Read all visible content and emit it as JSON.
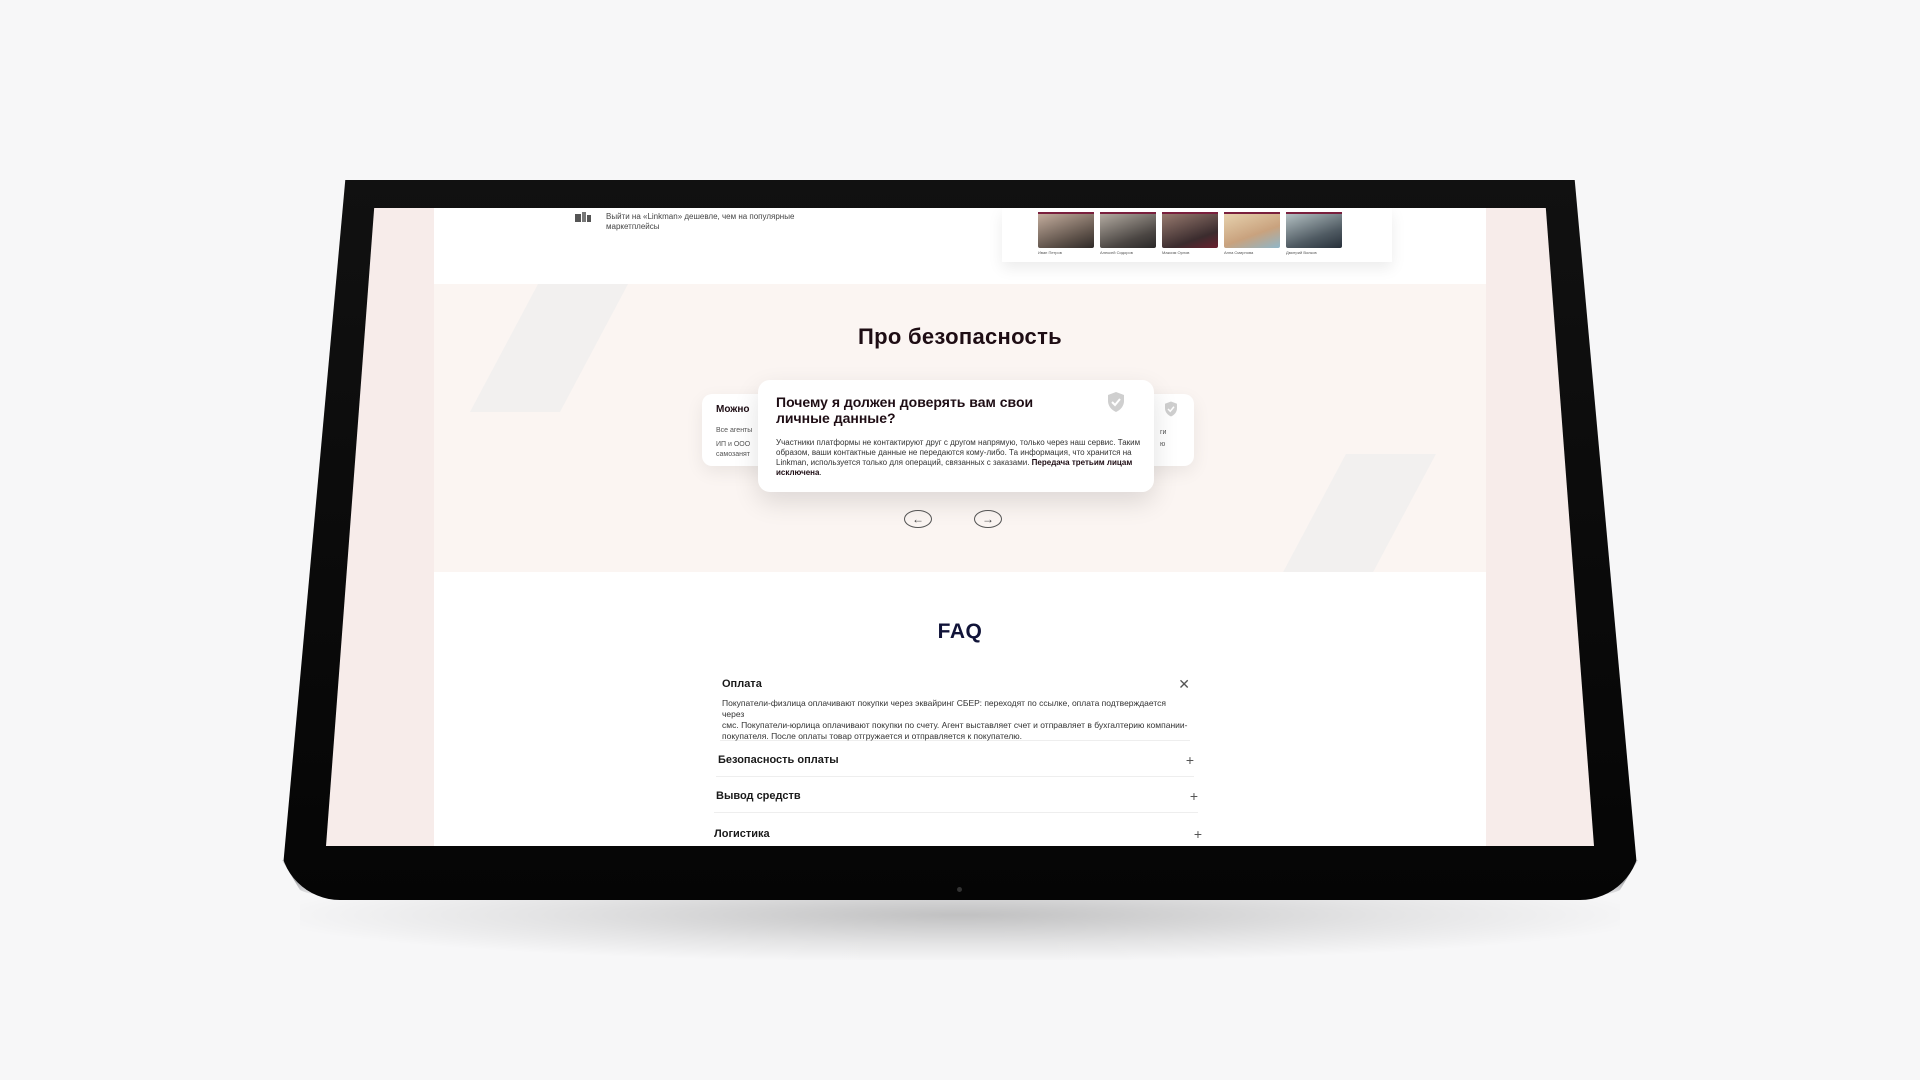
{
  "promo": {
    "text": "Выйти на «Linkman» дешевле, чем на популярные маркетплейсы"
  },
  "team": [
    {
      "name": "Иван Петров"
    },
    {
      "name": "Алексей Сидоров"
    },
    {
      "name": "Максим Орлов"
    },
    {
      "name": "Анна Смирнова"
    },
    {
      "name": "Дмитрий Волков"
    }
  ],
  "security": {
    "title": "Про безопасность",
    "main_card": {
      "title": "Почему я должен доверять вам свои личные данные?",
      "text_before": "Участники платформы не контактируют друг с другом напрямую, только через наш сервис. Таким образом, ваши контактные данные не передаются кому-либо. Та информация, что хранится на Linkman, используется только для операций, связанных с заказами. ",
      "text_bold": "Передача третьим лицам исключена",
      "text_after": "."
    },
    "left_card": {
      "title": "Можно",
      "line1": "Все агенты",
      "line2": "ИП и ООО",
      "line3": "самозанят"
    },
    "right_card": {
      "line1": "ги",
      "line2": "ю"
    },
    "prev_icon": "arrow-left-icon",
    "next_icon": "arrow-right-icon"
  },
  "faq": {
    "title": "FAQ",
    "items": [
      {
        "question": "Оплата",
        "toggle": "✕",
        "answer_line1": "Покупатели-физлица оплачивают покупки через эквайринг СБЕР: переходят по ссылке, оплата подтверждается через",
        "answer_line2": "смс. Покупатели-юрлица оплачивают покупки по счету. Агент выставляет счет и отправляет в бухгалтерию компании-",
        "answer_line3": "покупателя. После оплаты товар отгружается и отправляется к покупателю."
      },
      {
        "question": "Безопасность оплаты",
        "toggle": "+"
      },
      {
        "question": "Вывод средств",
        "toggle": "+"
      },
      {
        "question": "Логистика",
        "toggle": "+"
      }
    ]
  },
  "colors": {
    "accent": "#7a1f3d",
    "heading": "#1e0d14",
    "faq_heading": "#101338",
    "section_bg": "#fbf5f2"
  }
}
